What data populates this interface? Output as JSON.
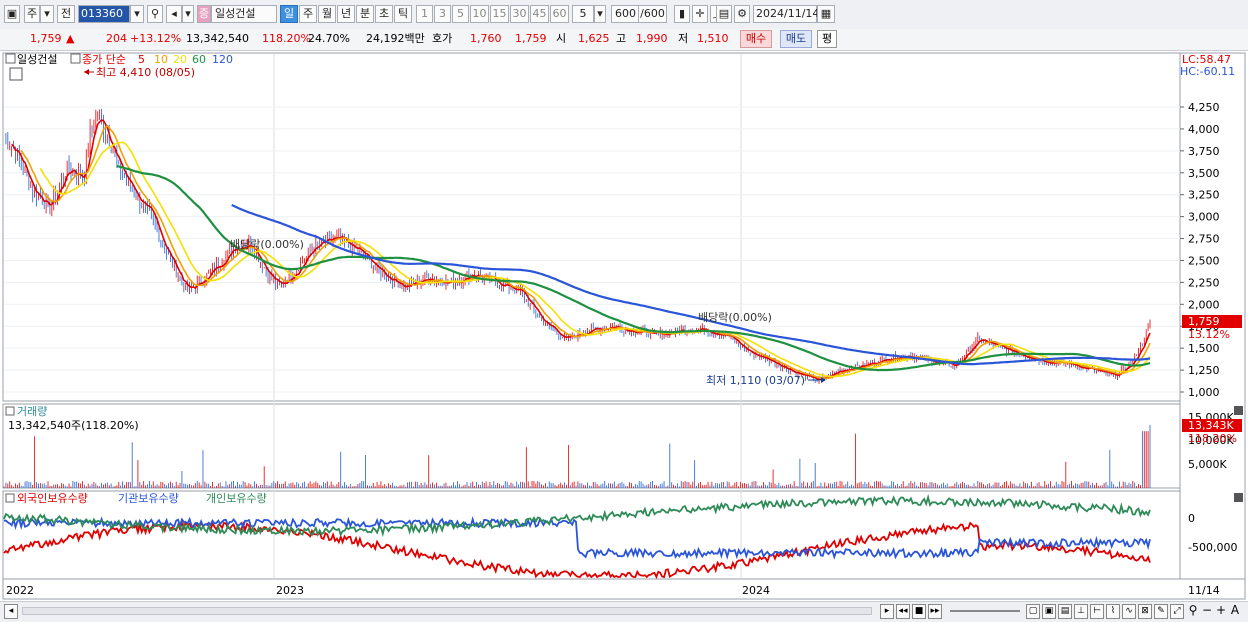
{
  "toolbar": {
    "market": "주",
    "prefix": "전",
    "code": "013360",
    "name": "일성건설",
    "period_tabs": [
      "일",
      "주",
      "월",
      "년",
      "분",
      "초",
      "틱"
    ],
    "active_period": "일",
    "intervals": [
      "1",
      "3",
      "5",
      "10",
      "15",
      "30",
      "45",
      "60"
    ],
    "interval_select": "5",
    "count": "600",
    "count_total": "/600",
    "date": "2024/11/14"
  },
  "quote": {
    "price": "1,759",
    "change": "204",
    "change_pct": "+13.12%",
    "volume": "13,342,540",
    "volume_ratio": "118.20%",
    "turnover": "24.70%",
    "amount": "24,192백만",
    "ask_label": "호가",
    "ask": "1,760",
    "bid": "1,759",
    "open_label": "시",
    "open": "1,625",
    "high_label": "고",
    "high": "1,990",
    "low_label": "저",
    "low": "1,510",
    "buy_label": "매수",
    "sell_label": "매도",
    "avg_label": "평"
  },
  "price_panel": {
    "name_label": "일성건설",
    "legend_title": "종가 단순",
    "ma_periods": [
      "5",
      "10",
      "20",
      "60",
      "120"
    ],
    "ma_colors": [
      "#e00000",
      "#f0a000",
      "#f5e000",
      "#1e9040",
      "#2a55d8"
    ],
    "high_note": "최고 4,410 (08/05)",
    "low_note": "최저 1,110 (03/07)",
    "div_note_1": "배당락(0.00%)",
    "div_note_2": "배당락(0.00%)",
    "lc_label": "LC:58.47",
    "hc_label": "HC:-60.11",
    "price_tag": "1,759",
    "pct_tag": "13.12%"
  },
  "volume_panel": {
    "title": "거래량",
    "current": "13,342,540주(118.20%)",
    "tag_value": "13,343K",
    "tag_pct": "118.20%"
  },
  "holdings_panel": {
    "legend": [
      "외국인보유수량",
      "기관보유수량",
      "개인보유수량"
    ],
    "colors": [
      "#e00000",
      "#2a55d8",
      "#2e8b57"
    ]
  },
  "x_axis": {
    "labels": [
      "2022",
      "2023",
      "2024"
    ],
    "end_label": "11/14"
  },
  "chart_data": {
    "type": "line",
    "title": "일성건설",
    "price_axis": {
      "ylim": [
        1000,
        4410
      ],
      "ticks": [
        "4,250",
        "4,000",
        "3,750",
        "3,500",
        "3,250",
        "3,000",
        "2,750",
        "2,500",
        "2,250",
        "2,000",
        "1,750",
        "1,500",
        "1,250",
        "1,000"
      ]
    },
    "volume_axis": {
      "ticks": [
        "15,000K",
        "10,000K",
        "5,000K"
      ]
    },
    "holdings_axis": {
      "ticks": [
        "0",
        "-500,000"
      ]
    },
    "price_series": [
      {
        "t": 0,
        "v": 3900
      },
      {
        "t": 0.01,
        "v": 3750
      },
      {
        "t": 0.025,
        "v": 3300
      },
      {
        "t": 0.04,
        "v": 3100
      },
      {
        "t": 0.055,
        "v": 3550
      },
      {
        "t": 0.07,
        "v": 3450
      },
      {
        "t": 0.075,
        "v": 3950
      },
      {
        "t": 0.082,
        "v": 4150
      },
      {
        "t": 0.09,
        "v": 3950
      },
      {
        "t": 0.1,
        "v": 3550
      },
      {
        "t": 0.115,
        "v": 3250
      },
      {
        "t": 0.13,
        "v": 2950
      },
      {
        "t": 0.145,
        "v": 2500
      },
      {
        "t": 0.16,
        "v": 2150
      },
      {
        "t": 0.175,
        "v": 2300
      },
      {
        "t": 0.19,
        "v": 2500
      },
      {
        "t": 0.2,
        "v": 2650
      },
      {
        "t": 0.215,
        "v": 2700
      },
      {
        "t": 0.23,
        "v": 2350
      },
      {
        "t": 0.24,
        "v": 2200
      },
      {
        "t": 0.255,
        "v": 2400
      },
      {
        "t": 0.27,
        "v": 2650
      },
      {
        "t": 0.29,
        "v": 2750
      },
      {
        "t": 0.31,
        "v": 2600
      },
      {
        "t": 0.33,
        "v": 2350
      },
      {
        "t": 0.35,
        "v": 2200
      },
      {
        "t": 0.37,
        "v": 2300
      },
      {
        "t": 0.39,
        "v": 2250
      },
      {
        "t": 0.41,
        "v": 2350
      },
      {
        "t": 0.43,
        "v": 2250
      },
      {
        "t": 0.45,
        "v": 2150
      },
      {
        "t": 0.47,
        "v": 1800
      },
      {
        "t": 0.49,
        "v": 1600
      },
      {
        "t": 0.51,
        "v": 1700
      },
      {
        "t": 0.53,
        "v": 1750
      },
      {
        "t": 0.55,
        "v": 1700
      },
      {
        "t": 0.57,
        "v": 1650
      },
      {
        "t": 0.59,
        "v": 1700
      },
      {
        "t": 0.61,
        "v": 1720
      },
      {
        "t": 0.63,
        "v": 1650
      },
      {
        "t": 0.65,
        "v": 1450
      },
      {
        "t": 0.67,
        "v": 1350
      },
      {
        "t": 0.69,
        "v": 1220
      },
      {
        "t": 0.71,
        "v": 1130
      },
      {
        "t": 0.73,
        "v": 1250
      },
      {
        "t": 0.75,
        "v": 1300
      },
      {
        "t": 0.77,
        "v": 1380
      },
      {
        "t": 0.79,
        "v": 1420
      },
      {
        "t": 0.81,
        "v": 1350
      },
      {
        "t": 0.83,
        "v": 1300
      },
      {
        "t": 0.85,
        "v": 1600
      },
      {
        "t": 0.87,
        "v": 1500
      },
      {
        "t": 0.89,
        "v": 1420
      },
      {
        "t": 0.91,
        "v": 1350
      },
      {
        "t": 0.93,
        "v": 1320
      },
      {
        "t": 0.95,
        "v": 1250
      },
      {
        "t": 0.97,
        "v": 1180
      },
      {
        "t": 0.985,
        "v": 1350
      },
      {
        "t": 1,
        "v": 1759
      }
    ]
  }
}
